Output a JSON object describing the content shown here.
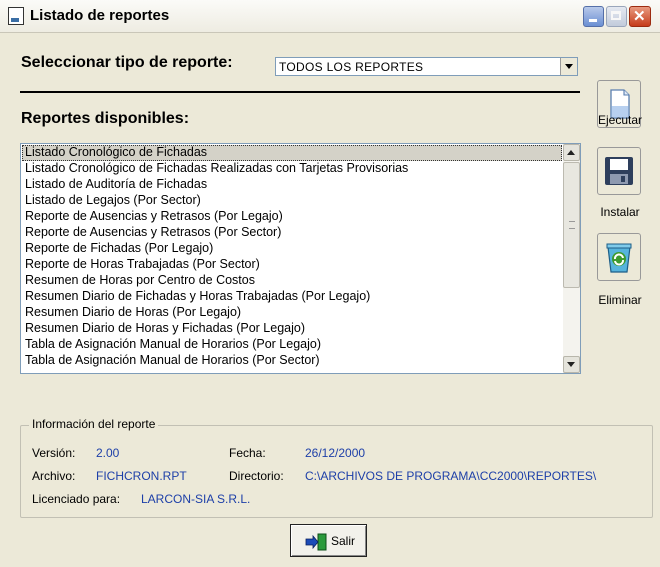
{
  "window": {
    "title": "Listado de reportes"
  },
  "report_type": {
    "label": "Seleccionar tipo de reporte:",
    "selected": "TODOS LOS REPORTES"
  },
  "available": {
    "label": "Reportes disponibles:",
    "items": [
      "Listado Cronológico de Fichadas",
      "Listado Cronológico de Fichadas Realizadas con Tarjetas Provisorias",
      "Listado de Auditoría de Fichadas",
      "Listado de Legajos (Por Sector)",
      "Reporte de Ausencias y Retrasos (Por Legajo)",
      "Reporte de Ausencias y Retrasos (Por Sector)",
      "Reporte de Fichadas (Por Legajo)",
      "Reporte de Horas Trabajadas (Por Sector)",
      "Resumen de Horas por Centro de Costos",
      "Resumen Diario de Fichadas y Horas Trabajadas (Por Legajo)",
      "Resumen Diario de Horas (Por Legajo)",
      "Resumen Diario de Horas y Fichadas (Por Legajo)",
      "Tabla de Asignación Manual de Horarios (Por Legajo)",
      "Tabla de Asignación Manual de Horarios (Por Sector)"
    ]
  },
  "actions": {
    "execute": "Ejecutar",
    "install": "Instalar",
    "delete": "Eliminar"
  },
  "info": {
    "title": "Información del reporte",
    "version_label": "Versión:",
    "version": "2.00",
    "date_label": "Fecha:",
    "date": "26/12/2000",
    "file_label": "Archivo:",
    "file": "FICHCRON.RPT",
    "dir_label": "Directorio:",
    "dir": "C:\\ARCHIVOS DE PROGRAMA\\CC2000\\REPORTES\\",
    "licensed_label": "Licenciado para:",
    "licensed": "LARCON-SIA S.R.L."
  },
  "exit": {
    "label": "Salir"
  },
  "colors": {
    "value_text": "#1d3fa8",
    "background": "#ece9d8"
  }
}
